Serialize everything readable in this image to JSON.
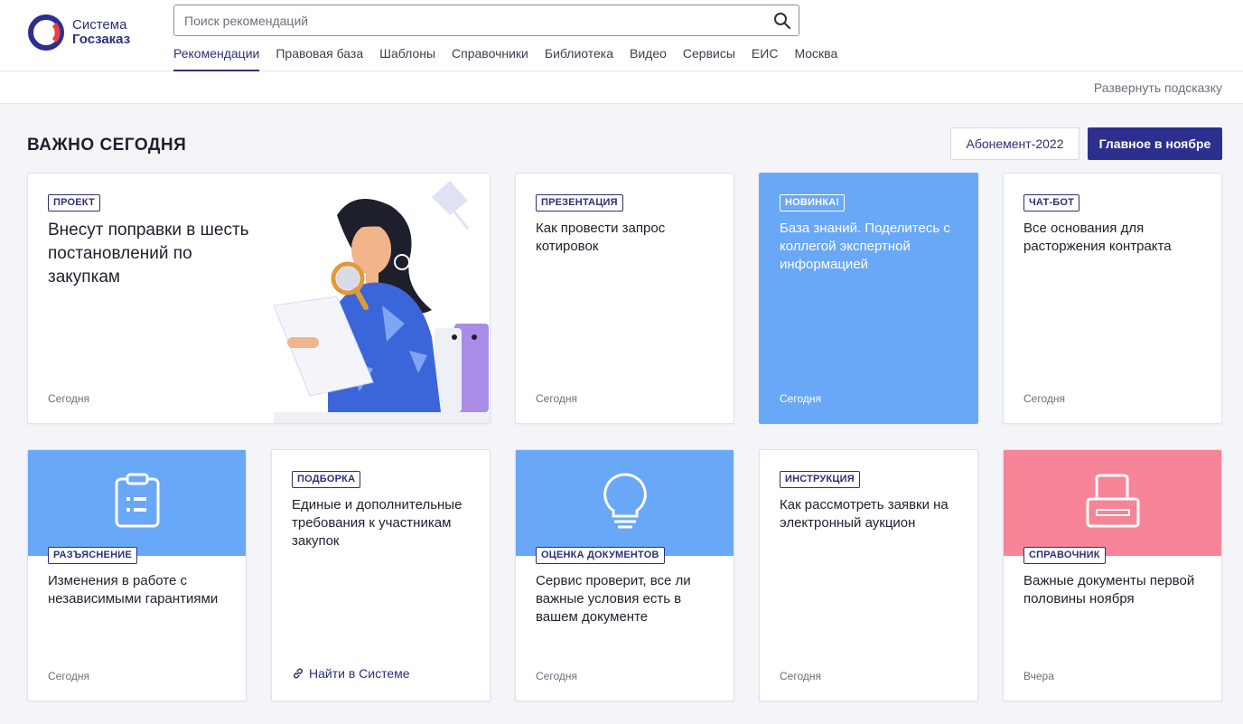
{
  "brand": {
    "line1": "Система",
    "line2": "Госзаказ"
  },
  "search": {
    "placeholder": "Поиск рекомендаций"
  },
  "nav": [
    {
      "label": "Рекомендации",
      "active": true
    },
    {
      "label": "Правовая база"
    },
    {
      "label": "Шаблоны"
    },
    {
      "label": "Справочники"
    },
    {
      "label": "Библиотека"
    },
    {
      "label": "Видео"
    },
    {
      "label": "Сервисы"
    },
    {
      "label": "ЕИС"
    },
    {
      "label": "Москва"
    }
  ],
  "hint_link": "Развернуть подсказку",
  "section": {
    "title": "ВАЖНО СЕГОДНЯ",
    "btn_outline": "Абонемент-2022",
    "btn_primary": "Главное в ноябре"
  },
  "cards": [
    {
      "tag": "ПРОЕКТ",
      "title": "Внесут поправки в шесть постановлений по закупкам",
      "date": "Сегодня"
    },
    {
      "tag": "ПРЕЗЕНТАЦИЯ",
      "title": "Как провести запрос котировок",
      "date": "Сегодня"
    },
    {
      "tag": "НОВИНКА!",
      "title": "База знаний. Поделитесь с коллегой экспертной информацией",
      "date": "Сегодня"
    },
    {
      "tag": "ЧАТ-БОТ",
      "title": "Все основания для расторжения контракта",
      "date": "Сегодня"
    },
    {
      "tag": "РАЗЪЯСНЕНИЕ",
      "title": "Изменения в работе с независимыми гарантиями",
      "date": "Сегодня",
      "icon": "clipboard-icon"
    },
    {
      "tag": "ПОДБОРКА",
      "title": "Единые и дополнительные требования к участникам закупок",
      "link": "Найти в Системе"
    },
    {
      "tag": "ОЦЕНКА ДОКУМЕНТОВ",
      "title": "Сервис проверит, все ли важные условия есть в вашем документе",
      "date": "Сегодня",
      "icon": "lightbulb-icon"
    },
    {
      "tag": "ИНСТРУКЦИЯ",
      "title": "Как рассмотреть заявки на электронный аукцион",
      "date": "Сегодня"
    },
    {
      "tag": "СПРАВОЧНИК",
      "title": "Важные документы первой половины ноября",
      "date": "Вчера",
      "icon": "printer-icon"
    }
  ],
  "colors": {
    "accent": "#2d2f8f",
    "blue_card": "#69a7f7",
    "pink_card": "#f78497",
    "logo_red": "#e8423f"
  }
}
